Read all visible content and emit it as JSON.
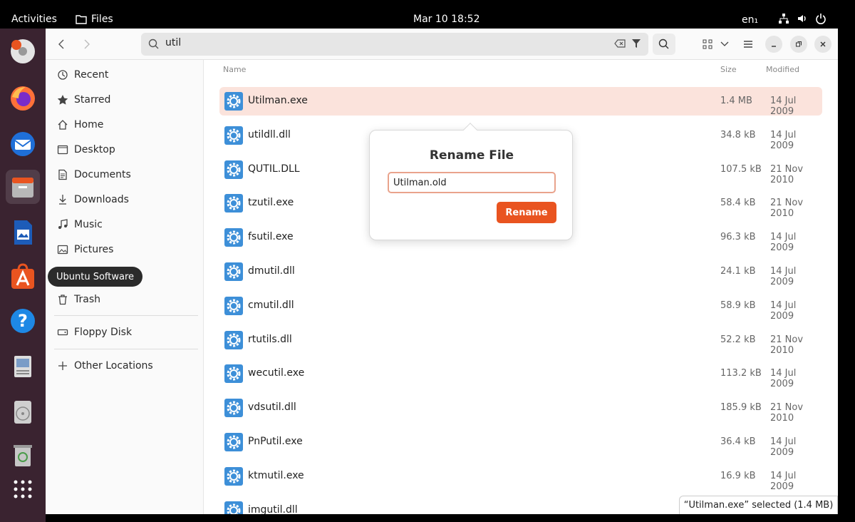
{
  "topbar": {
    "activities": "Activities",
    "app_name": "Files",
    "clock": "Mar 10  18:52",
    "lang": "en₁"
  },
  "search": {
    "value": "util"
  },
  "sidebar": {
    "items": [
      {
        "label": "Recent",
        "icon": "recent-icon"
      },
      {
        "label": "Starred",
        "icon": "star-icon"
      },
      {
        "label": "Home",
        "icon": "home-icon"
      },
      {
        "label": "Desktop",
        "icon": "desktop-icon"
      },
      {
        "label": "Documents",
        "icon": "documents-icon"
      },
      {
        "label": "Downloads",
        "icon": "downloads-icon"
      },
      {
        "label": "Music",
        "icon": "music-icon"
      },
      {
        "label": "Pictures",
        "icon": "pictures-icon"
      },
      {
        "label": "Trash",
        "icon": "trash-icon"
      },
      {
        "label": "Floppy Disk",
        "icon": "drive-icon"
      },
      {
        "label": "Other Locations",
        "icon": "plus-icon"
      }
    ]
  },
  "tooltip": "Ubuntu Software",
  "columns": {
    "name": "Name",
    "size": "Size",
    "modified": "Modified"
  },
  "files": [
    {
      "name": "Utilman.exe",
      "size": "1.4 MB",
      "date": "14 Jul 2009"
    },
    {
      "name": "utildll.dll",
      "size": "34.8 kB",
      "date": "14 Jul 2009"
    },
    {
      "name": "QUTIL.DLL",
      "size": "107.5 kB",
      "date": "21 Nov 2010"
    },
    {
      "name": "tzutil.exe",
      "size": "58.4 kB",
      "date": "21 Nov 2010"
    },
    {
      "name": "fsutil.exe",
      "size": "96.3 kB",
      "date": "14 Jul 2009"
    },
    {
      "name": "dmutil.dll",
      "size": "24.1 kB",
      "date": "14 Jul 2009"
    },
    {
      "name": "cmutil.dll",
      "size": "58.9 kB",
      "date": "14 Jul 2009"
    },
    {
      "name": "rtutils.dll",
      "size": "52.2 kB",
      "date": "21 Nov 2010"
    },
    {
      "name": "wecutil.exe",
      "size": "113.2 kB",
      "date": "14 Jul 2009"
    },
    {
      "name": "vdsutil.dll",
      "size": "185.9 kB",
      "date": "21 Nov 2010"
    },
    {
      "name": "PnPutil.exe",
      "size": "36.4 kB",
      "date": "14 Jul 2009"
    },
    {
      "name": "ktmutil.exe",
      "size": "16.9 kB",
      "date": "14 Jul 2009"
    },
    {
      "name": "imgutil.dll",
      "size": "",
      "date": ""
    }
  ],
  "rename": {
    "title": "Rename File",
    "value": "Utilman.old",
    "button": "Rename"
  },
  "status": "“Utilman.exe” selected  (1.4 MB)",
  "colors": {
    "accent": "#e95420",
    "selected_row": "#fbe3dc",
    "dock": "#3a2330"
  }
}
